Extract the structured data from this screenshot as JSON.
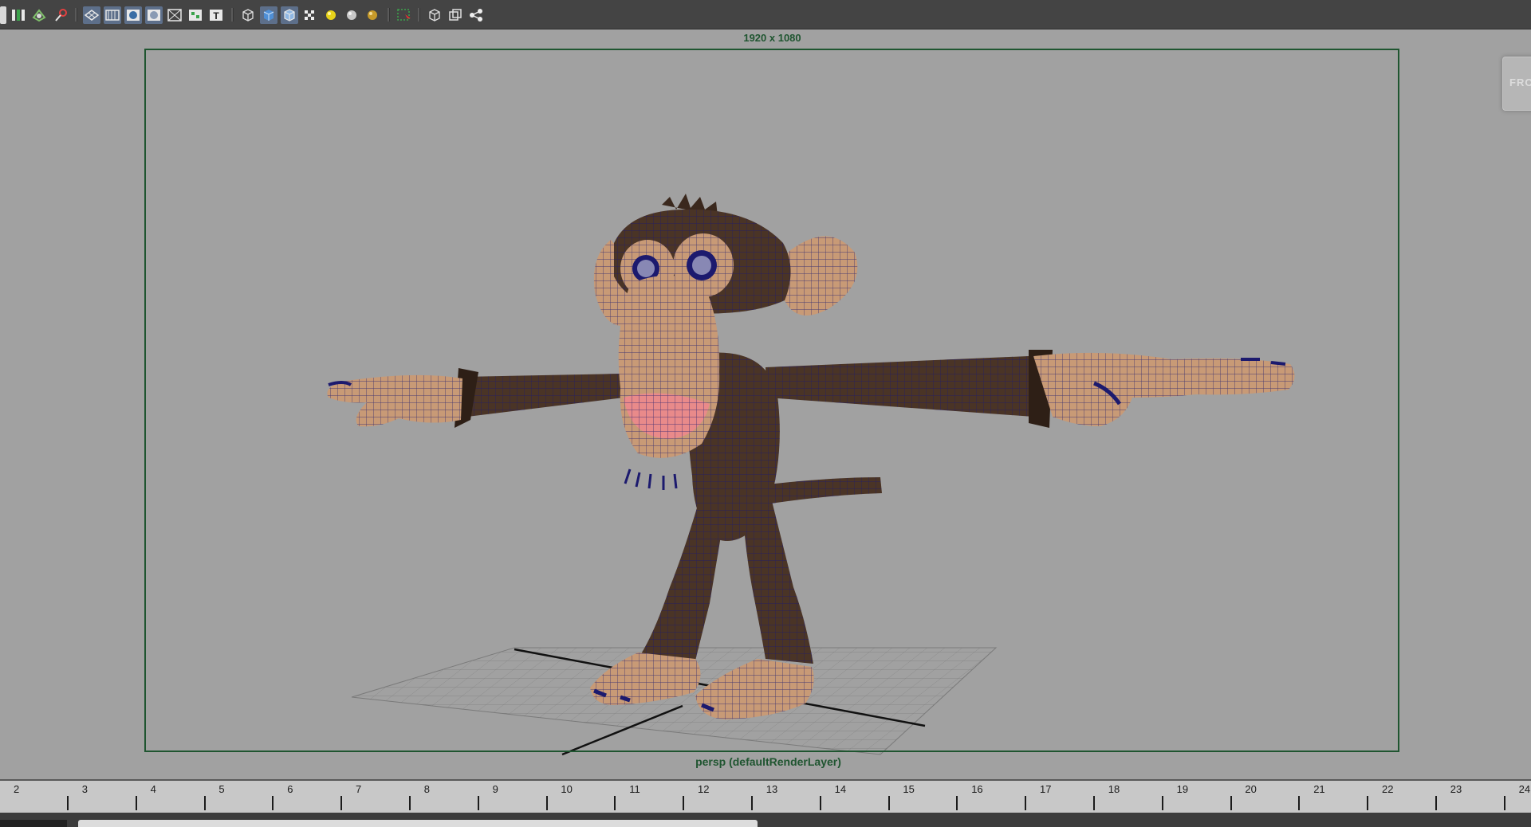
{
  "toolbar": {
    "buttons": [
      {
        "name": "channel-box-icon"
      },
      {
        "name": "isolate-select-icon"
      },
      {
        "name": "xray-icon"
      },
      {
        "name": "display-layers-icon"
      },
      {
        "name": "grid-toggle-icon"
      },
      {
        "name": "film-gate-icon"
      },
      {
        "name": "resolution-gate-icon"
      },
      {
        "name": "safe-action-icon"
      },
      {
        "name": "field-chart-icon"
      },
      {
        "name": "safe-title-icon"
      },
      {
        "name": "wireframe-icon"
      },
      {
        "name": "smooth-shade-icon"
      },
      {
        "name": "wireframe-on-shaded-icon"
      },
      {
        "name": "textured-icon"
      },
      {
        "name": "use-all-lights-icon"
      },
      {
        "name": "shadows-icon"
      },
      {
        "name": "hardware-texturing-icon"
      },
      {
        "name": "select-camera-icon"
      },
      {
        "name": "frame-all-icon"
      },
      {
        "name": "frame-selected-icon"
      },
      {
        "name": "node-editor-icon"
      }
    ]
  },
  "viewport": {
    "resolution_label": "1920 x 1080",
    "camera_label": "persp (defaultRenderLayer)",
    "viewcube_label": "FRON"
  },
  "timeslider": {
    "frames": [
      "2",
      "3",
      "4",
      "5",
      "6",
      "7",
      "8",
      "9",
      "10",
      "11",
      "12",
      "13",
      "14",
      "15",
      "16",
      "17",
      "18",
      "19",
      "20",
      "21",
      "22",
      "23",
      "24"
    ]
  },
  "colors": {
    "viewport_bg": "#a1a1a1",
    "gate_border": "#1f5530",
    "mesh_fill": "#4a3426",
    "skin_fill": "#c89a76",
    "wire": "#1c1a6e"
  }
}
